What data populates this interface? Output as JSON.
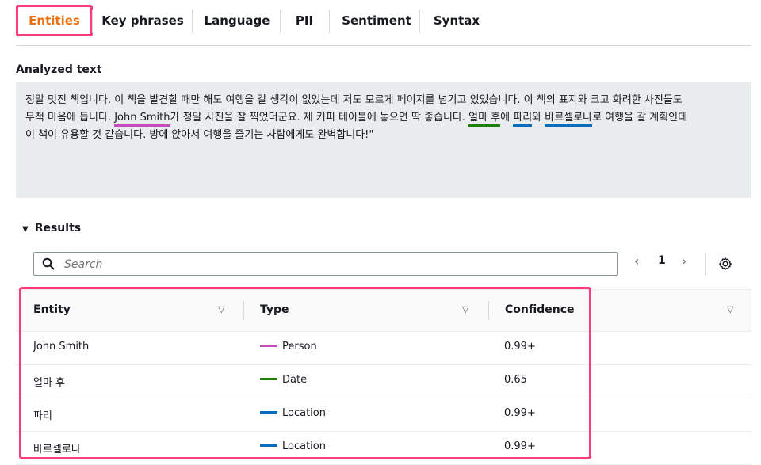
{
  "tabs": [
    {
      "label": "Entities",
      "active": true
    },
    {
      "label": "Key phrases",
      "active": false
    },
    {
      "label": "Language",
      "active": false
    },
    {
      "label": "PII",
      "active": false
    },
    {
      "label": "Sentiment",
      "active": false
    },
    {
      "label": "Syntax",
      "active": false
    }
  ],
  "analyzed": {
    "title": "Analyzed text",
    "line1": "정말 멋진 책입니다. 이 책을 발견할 때만 해도 여행을 갈 생각이 없었는데 저도 모르게 페이지를 넘기고 있었습니다. 이 책의 표지와 크고 화려한 사진들도",
    "line2_a": "무척 마음에 듭니다. ",
    "line2_person": "John Smith",
    "line2_b": "가 정말 사진을 잘 찍었더군요. 제 커피 테이블에 놓으면 딱 좋습니다. ",
    "line2_date": "얼마 후",
    "line2_c": "에 ",
    "line2_loc1": "파리",
    "line2_d": "와 ",
    "line2_loc2": "바르셀로나",
    "line2_e": "로 여행을 갈 계획인데",
    "line3": "이 책이 유용할 것 같습니다. 방에 앉아서 여행을 즐기는 사람에게도 완벽합니다!\""
  },
  "results": {
    "title": "Results",
    "search_placeholder": "Search",
    "page": "1",
    "columns": [
      "Entity",
      "Type",
      "Confidence"
    ],
    "rows": [
      {
        "entity": "John Smith",
        "type": "Person",
        "confidence": "0.99+"
      },
      {
        "entity": "얼마 후",
        "type": "Date",
        "confidence": "0.65"
      },
      {
        "entity": "파리",
        "type": "Location",
        "confidence": "0.99+"
      },
      {
        "entity": "바르셀로나",
        "type": "Location",
        "confidence": "0.99+"
      }
    ]
  },
  "colors": {
    "person": "#c44cbf",
    "date": "#1d8102",
    "location": "#0a6ebd",
    "active_tab": "#ec7211",
    "annotation_highlight": "#ff3b7a"
  },
  "icons": {
    "search": "search-icon",
    "prev": "chevron-left-icon",
    "next": "chevron-right-icon",
    "settings": "gear-icon",
    "sort": "sort-down-icon",
    "collapse": "caret-down-icon"
  }
}
